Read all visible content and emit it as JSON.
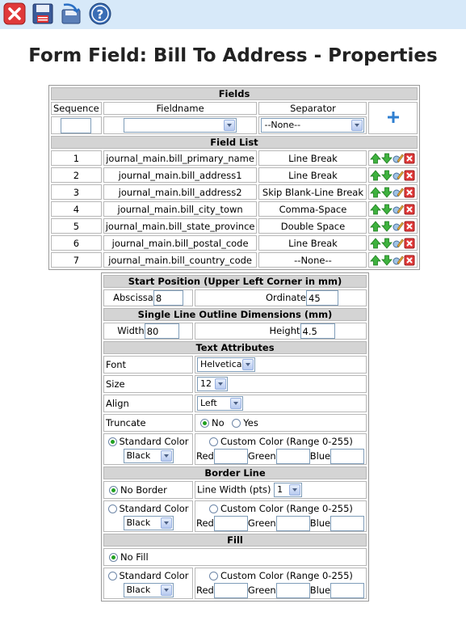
{
  "toolbar": {
    "icons": [
      "close-icon",
      "save-icon",
      "save-copy-icon",
      "help-icon"
    ]
  },
  "page_title": "Form Field: Bill To Address - Properties",
  "fields": {
    "section_title": "Fields",
    "col_sequence": "Sequence",
    "col_fieldname": "Fieldname",
    "col_separator": "Separator",
    "sequence_value": "",
    "fieldname_value": "",
    "separator_value": "--None--",
    "field_list_title": "Field List",
    "rows": [
      {
        "seq": "1",
        "name": "journal_main.bill_primary_name",
        "sep": "Line Break"
      },
      {
        "seq": "2",
        "name": "journal_main.bill_address1",
        "sep": "Line Break"
      },
      {
        "seq": "3",
        "name": "journal_main.bill_address2",
        "sep": "Skip Blank-Line Break"
      },
      {
        "seq": "4",
        "name": "journal_main.bill_city_town",
        "sep": "Comma-Space"
      },
      {
        "seq": "5",
        "name": "journal_main.bill_state_province",
        "sep": "Double Space"
      },
      {
        "seq": "6",
        "name": "journal_main.bill_postal_code",
        "sep": "Line Break"
      },
      {
        "seq": "7",
        "name": "journal_main.bill_country_code",
        "sep": "--None--"
      }
    ]
  },
  "start_position": {
    "title": "Start Position (Upper Left Corner in mm)",
    "abscissa_label": "Abscissa",
    "abscissa_value": "8",
    "ordinate_label": "Ordinate",
    "ordinate_value": "45"
  },
  "dimensions": {
    "title": "Single Line Outline Dimensions (mm)",
    "width_label": "Width",
    "width_value": "80",
    "height_label": "Height",
    "height_value": "4.5"
  },
  "text_attributes": {
    "title": "Text Attributes",
    "font_label": "Font",
    "font_value": "Helvetica",
    "size_label": "Size",
    "size_value": "12",
    "align_label": "Align",
    "align_value": "Left",
    "truncate_label": "Truncate",
    "truncate_no": "No",
    "truncate_yes": "Yes",
    "standard_color": "Standard Color",
    "color_value": "Black",
    "custom_color": "Custom Color (Range 0-255)",
    "red": "Red",
    "green": "Green",
    "blue": "Blue"
  },
  "border_line": {
    "title": "Border Line",
    "no_border": "No Border",
    "line_width_label": "Line Width (pts)",
    "line_width_value": "1",
    "standard_color": "Standard Color",
    "color_value": "Black",
    "custom_color": "Custom Color (Range 0-255)",
    "red": "Red",
    "green": "Green",
    "blue": "Blue"
  },
  "fill": {
    "title": "Fill",
    "no_fill": "No Fill",
    "standard_color": "Standard Color",
    "color_value": "Black",
    "custom_color": "Custom Color (Range 0-255)",
    "red": "Red",
    "green": "Green",
    "blue": "Blue"
  },
  "colors": {
    "toolbar_bg": "#d7e9f9",
    "section_bg": "#d4d4d4",
    "accent_blue": "#2f7fd0"
  }
}
